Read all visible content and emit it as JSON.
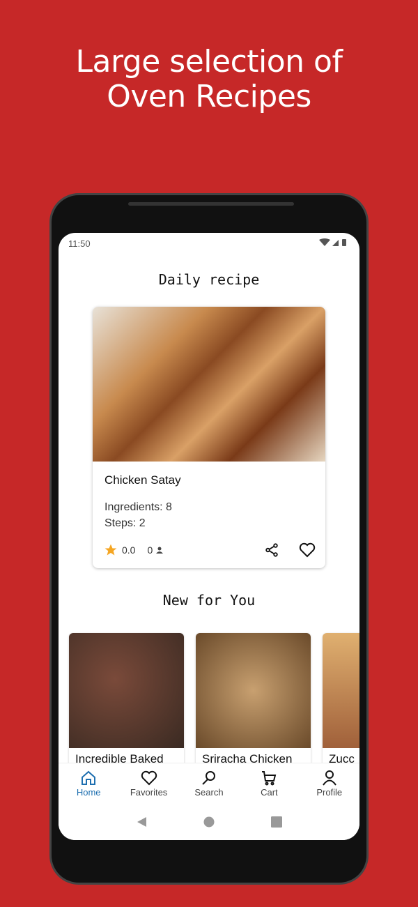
{
  "headline": {
    "line1": "Large selection of",
    "line2": "Oven Recipes"
  },
  "status": {
    "time": "11:50"
  },
  "daily": {
    "title": "Daily recipe",
    "recipe": {
      "name": "Chicken Satay",
      "ingredients": "Ingredients: 8",
      "steps": "Steps: 2",
      "rating": "0.0",
      "reviews": "0"
    }
  },
  "new_for_you": {
    "title": "New for You",
    "items": [
      {
        "name": "Incredible Baked"
      },
      {
        "name": "Sriracha Chicken"
      },
      {
        "name": "Zucc"
      }
    ]
  },
  "nav": {
    "items": [
      {
        "label": "Home",
        "icon": "home-icon",
        "active": true
      },
      {
        "label": "Favorites",
        "icon": "heart-icon"
      },
      {
        "label": "Search",
        "icon": "search-icon"
      },
      {
        "label": "Cart",
        "icon": "cart-icon"
      },
      {
        "label": "Profile",
        "icon": "profile-icon"
      }
    ]
  },
  "colors": {
    "background": "#c62828",
    "accent": "#1e6fb0",
    "star": "#f5a623"
  }
}
